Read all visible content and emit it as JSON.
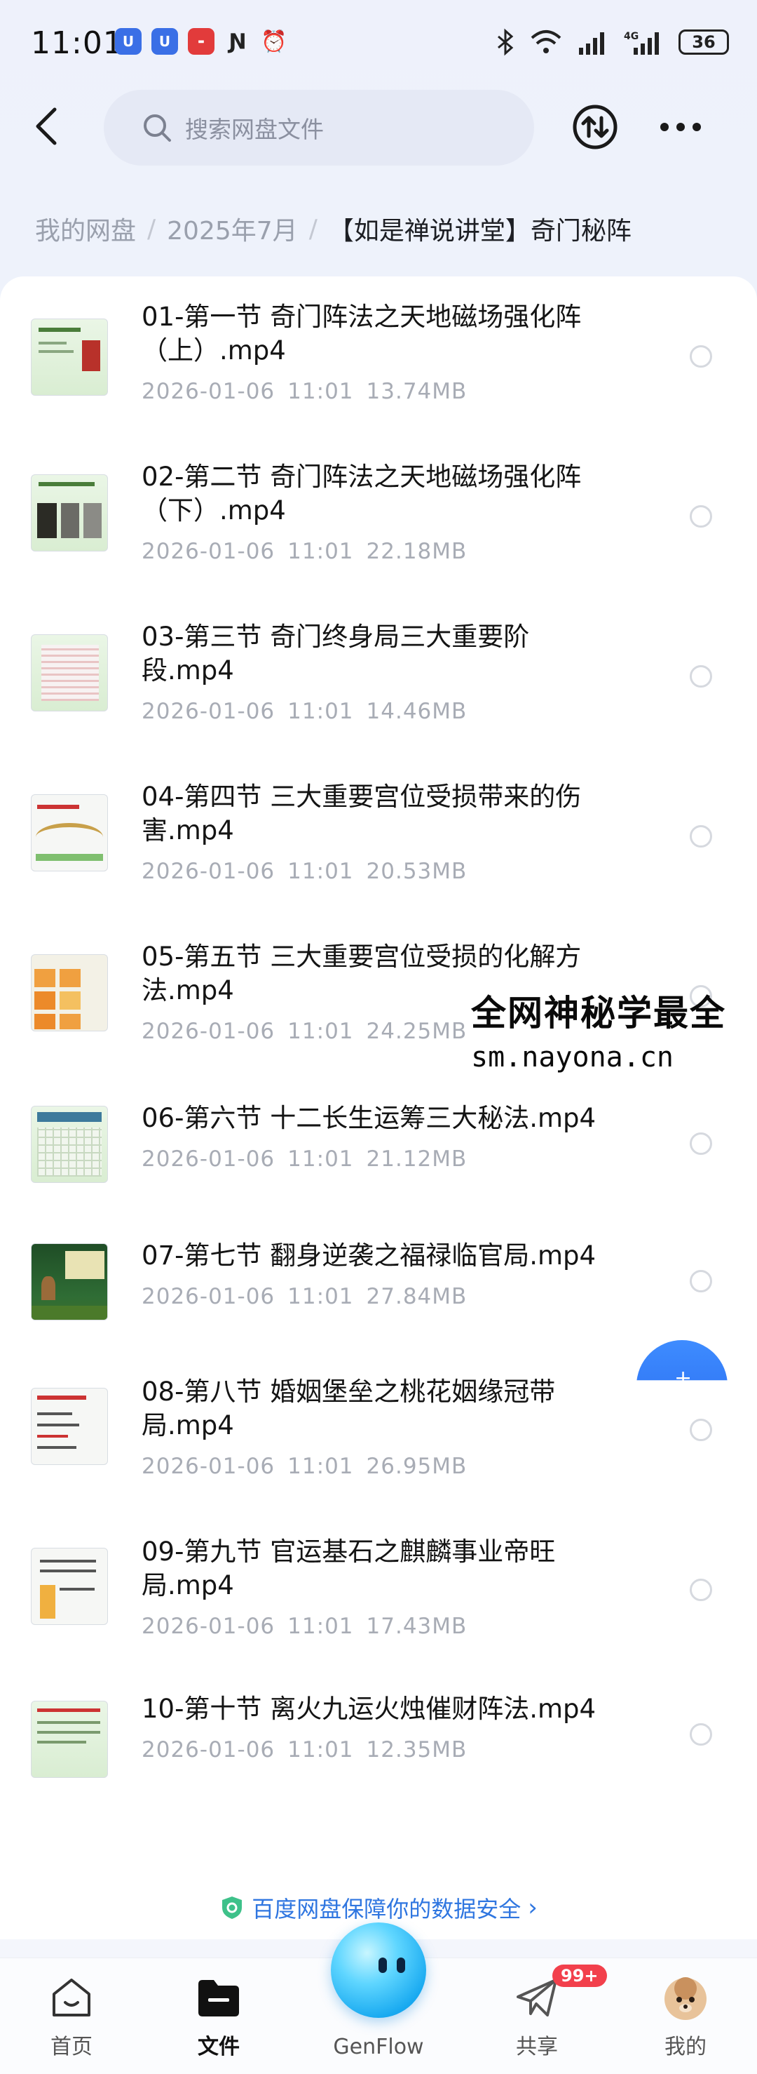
{
  "status_bar": {
    "time": "11:01",
    "battery": "36",
    "network": "4G"
  },
  "search": {
    "placeholder": "搜索网盘文件"
  },
  "breadcrumb": {
    "root": "我的网盘",
    "folder": "2025年7月",
    "current": "【如是禅说讲堂】奇门秘阵"
  },
  "files": [
    {
      "line1": "01-第一节 奇门阵法之天地磁场强化阵",
      "line2": "（上）.mp4",
      "date": "2026-01-06",
      "time": "11:01",
      "size": "13.74MB",
      "thumb": "green"
    },
    {
      "line1": "02-第二节 奇门阵法之天地磁场强化阵",
      "line2": "（下）.mp4",
      "date": "2026-01-06",
      "time": "11:01",
      "size": "22.18MB",
      "thumb": "dark"
    },
    {
      "line1": "03-第三节 奇门终身局三大重要阶",
      "line2": "段.mp4",
      "date": "2026-01-06",
      "time": "11:01",
      "size": "14.46MB",
      "thumb": "green"
    },
    {
      "line1": "04-第四节 三大重要宫位受损带来的伤",
      "line2": "害.mp4",
      "date": "2026-01-06",
      "time": "11:01",
      "size": "20.53MB",
      "thumb": "white"
    },
    {
      "line1": "05-第五节 三大重要宫位受损的化解方",
      "line2": "法.mp4",
      "date": "2026-01-06",
      "time": "11:01",
      "size": "24.25MB",
      "thumb": "orange"
    },
    {
      "line1": "06-第六节 十二长生运筹三大秘法.mp4",
      "line2": "",
      "date": "2026-01-06",
      "time": "11:01",
      "size": "21.12MB",
      "thumb": "green"
    },
    {
      "line1": "07-第七节 翻身逆袭之福禄临官局.mp4",
      "line2": "",
      "date": "2026-01-06",
      "time": "11:01",
      "size": "27.84MB",
      "thumb": "forest"
    },
    {
      "line1": "08-第八节 婚姻堡垒之桃花姻缘冠带",
      "line2": "局.mp4",
      "date": "2026-01-06",
      "time": "11:01",
      "size": "26.95MB",
      "thumb": "white"
    },
    {
      "line1": "09-第九节 官运基石之麒麟事业帝旺",
      "line2": "局.mp4",
      "date": "2026-01-06",
      "time": "11:01",
      "size": "17.43MB",
      "thumb": "white"
    },
    {
      "line1": "10-第十节 离火九运火烛催财阵法.mp4",
      "line2": "",
      "date": "2026-01-06",
      "time": "11:01",
      "size": "12.35MB",
      "thumb": "green"
    }
  ],
  "watermark": {
    "line1": "全网神秘学最全",
    "line2": "sm.nayona.cn"
  },
  "security_notice": "百度网盘保障你的数据安全",
  "tabs": {
    "home": "首页",
    "files": "文件",
    "genflow": "GenFlow",
    "share": "共享",
    "mine": "我的"
  },
  "share_badge": "99+",
  "colors": {
    "accent": "#2f76e0",
    "badge": "#f2404c",
    "meta_text": "#a8acb5"
  }
}
